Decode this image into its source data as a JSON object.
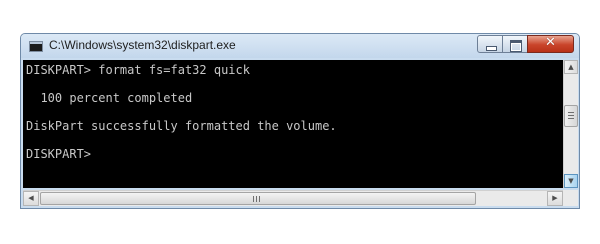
{
  "window": {
    "title": "C:\\Windows\\system32\\diskpart.exe",
    "icon": "console-icon"
  },
  "titlebar_buttons": {
    "minimize": "minimize-icon",
    "maximize": "maximize-icon",
    "close": "close-icon",
    "close_color": "#c9442a"
  },
  "console": {
    "background": "#000000",
    "foreground": "#c8c8c8",
    "lines": [
      "DISKPART> format fs=fat32 quick",
      "",
      "  100 percent completed",
      "",
      "DiskPart successfully formatted the volume.",
      "",
      "DISKPART>"
    ]
  },
  "scrollbars": {
    "up_arrow": "▲",
    "down_arrow": "▼",
    "left_arrow": "◀",
    "right_arrow": "▶"
  }
}
